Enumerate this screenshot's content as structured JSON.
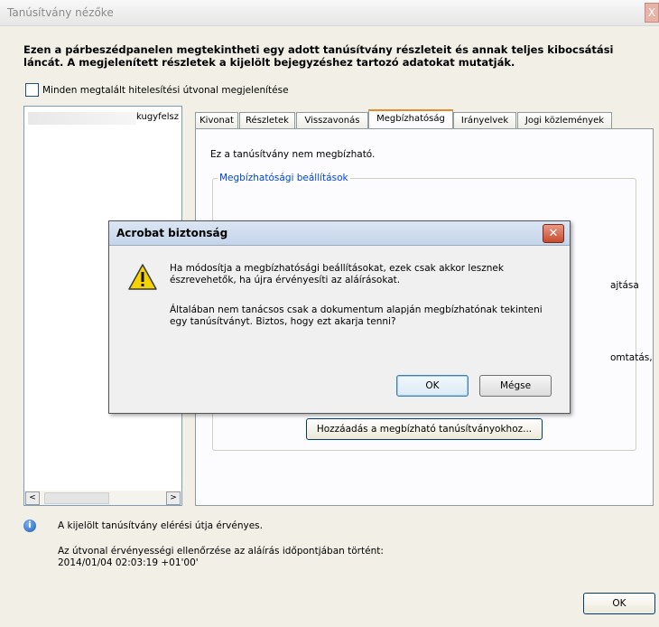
{
  "window": {
    "title": "Tanúsítvány nézőke",
    "close_glyph": "X",
    "intro": "Ezen a párbeszédpanelen megtekintheti egy adott tanúsítvány részleteit és annak teljes kibocsátási láncát. A megjelenített részletek a kijelölt bejegyzéshez tartozó adatokat mutatják.",
    "show_all_paths_label": "Minden megtalált hitelesítési útvonal megjelenítése",
    "show_all_paths_checked": false
  },
  "tree": {
    "node_label": "kugyfelsz"
  },
  "hscroll": {
    "left": "<",
    "right": ">"
  },
  "tabs": [
    {
      "label": "Kivonat"
    },
    {
      "label": "Részletek"
    },
    {
      "label": "Visszavonás"
    },
    {
      "label": "Megbízhatóság",
      "active": true
    },
    {
      "label": "Irányelvek"
    },
    {
      "label": "Jogi közlemények"
    }
  ],
  "trust_panel": {
    "message": "Ez a tanúsítvány nem megbízható.",
    "group_title": "Megbízhatósági beállítások",
    "fragment_1": "ajtása",
    "fragment_2": "omtatás,",
    "add_button": "Hozzáadás a megbízható tanúsítványokhoz..."
  },
  "status": {
    "valid_path": "A kijelölt tanúsítvány elérési útja érvényes.",
    "check_line": "Az útvonal érvényességi ellenőrzése az aláírás időpontjában történt:",
    "timestamp": "2014/01/04 02:03:19 +01'00'"
  },
  "main_ok": "OK",
  "dialog": {
    "title": "Acrobat biztonság",
    "close_glyph": "✕",
    "message_1": "Ha módosítja a megbízhatósági beállításokat, ezek csak akkor lesznek észrevehetők, ha újra érvényesíti az aláírásokat.",
    "message_2": "Általában nem tanácsos csak a dokumentum alapján megbízhatónak tekinteni egy tanúsítványt. Biztos, hogy ezt akarja tenni?",
    "ok": "OK",
    "cancel": "Mégse"
  },
  "colors": {
    "tab_accent": "#e68b2c",
    "legend_text": "#0046d5",
    "dialog_close": "#c74a2e"
  },
  "icons": {
    "info": "info-icon",
    "warning": "warning-icon",
    "close": "close-icon"
  }
}
